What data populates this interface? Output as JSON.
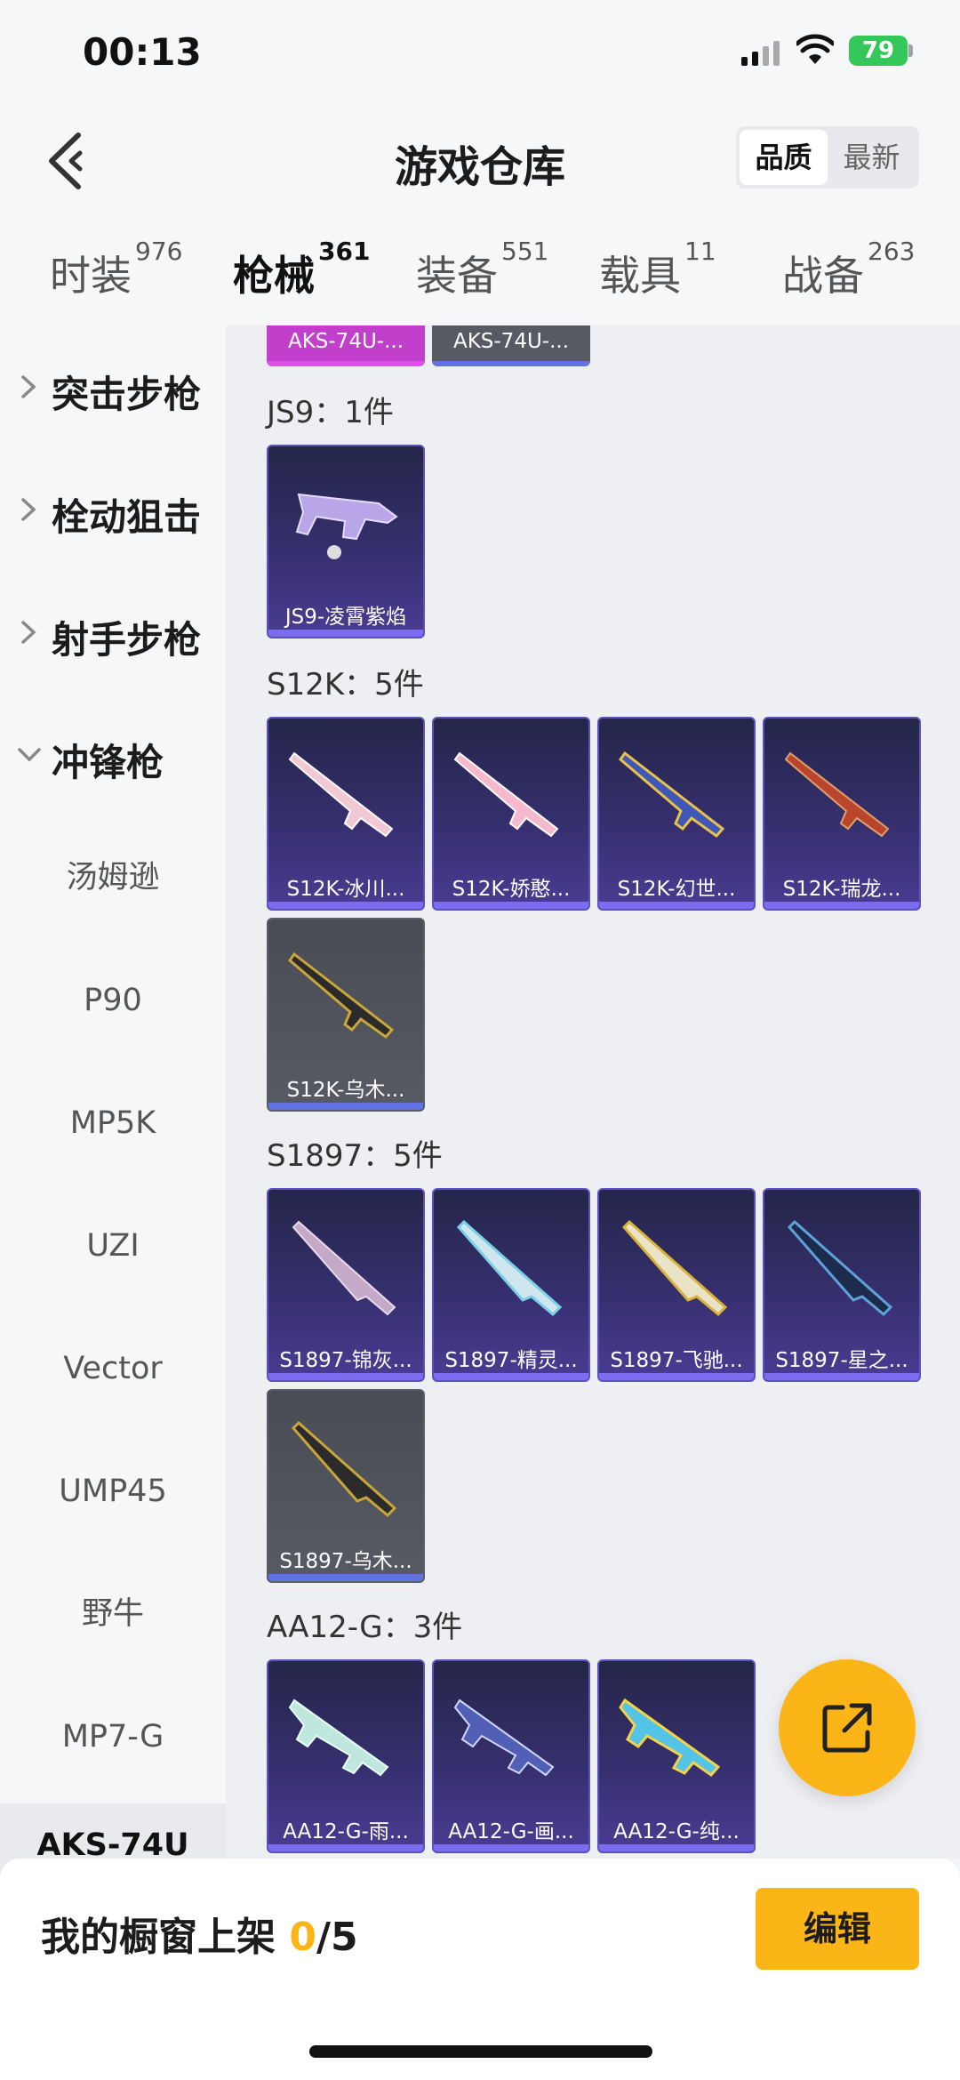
{
  "status_bar": {
    "time": "00:13",
    "battery": "79"
  },
  "header": {
    "title": "游戏仓库",
    "sort_options": [
      "品质",
      "最新"
    ],
    "sort_selected": "品质"
  },
  "tabs": [
    {
      "label": "时装",
      "count": "976"
    },
    {
      "label": "枪械",
      "count": "361"
    },
    {
      "label": "装备",
      "count": "551"
    },
    {
      "label": "载具",
      "count": "11"
    },
    {
      "label": "战备",
      "count": "263"
    }
  ],
  "active_tab": "枪械",
  "sidebar": {
    "groups": [
      {
        "label": "突击步枪",
        "expanded": false
      },
      {
        "label": "栓动狙击",
        "expanded": false
      },
      {
        "label": "射手步枪",
        "expanded": false
      },
      {
        "label": "冲锋枪",
        "expanded": true
      }
    ],
    "subitems": [
      "汤姆逊",
      "P90",
      "MP5K",
      "UZI",
      "Vector",
      "UMP45",
      "野牛",
      "MP7-G",
      "AKS-74U"
    ]
  },
  "content": {
    "top_partial": [
      "AKS-74U-...",
      "AKS-74U-..."
    ],
    "sections": [
      {
        "title": "JS9：1件",
        "items": [
          {
            "name": "JS9-凌霄紫焰",
            "grade": "purple"
          }
        ]
      },
      {
        "title": "S12K：5件",
        "items": [
          {
            "name": "S12K-冰川...",
            "grade": "purple"
          },
          {
            "name": "S12K-娇憨...",
            "grade": "purple"
          },
          {
            "name": "S12K-幻世...",
            "grade": "purple"
          },
          {
            "name": "S12K-瑞龙...",
            "grade": "purple"
          },
          {
            "name": "S12K-乌木...",
            "grade": "grey"
          }
        ]
      },
      {
        "title": "S1897：5件",
        "items": [
          {
            "name": "S1897-锦灰...",
            "grade": "purple"
          },
          {
            "name": "S1897-精灵...",
            "grade": "purple"
          },
          {
            "name": "S1897-飞驰...",
            "grade": "purple"
          },
          {
            "name": "S1897-星之...",
            "grade": "purple"
          },
          {
            "name": "S1897-乌木...",
            "grade": "grey"
          }
        ]
      },
      {
        "title": "AA12-G：3件",
        "items": [
          {
            "name": "AA12-G-雨...",
            "grade": "purple"
          },
          {
            "name": "AA12-G-画...",
            "grade": "purple"
          },
          {
            "name": "AA12-G-纯...",
            "grade": "purple"
          }
        ]
      }
    ]
  },
  "bottom_bar": {
    "label": "我的橱窗上架",
    "current": "0",
    "max": "/5",
    "edit_label": "编辑"
  },
  "colors": {
    "accent": "#fbb516",
    "purple_card": "#3a3275",
    "grey_card": "#575a63"
  },
  "icons": {
    "back": "chevron-left-icon",
    "share": "share-external-icon"
  }
}
